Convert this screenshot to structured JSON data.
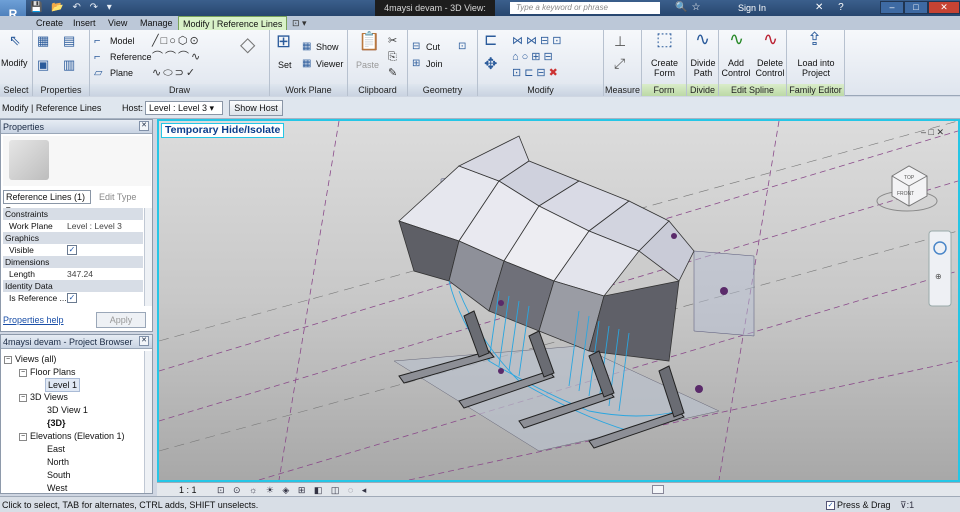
{
  "app": {
    "title": "4maysi devam - 3D View: {3D}",
    "app_button": "R"
  },
  "titlebar": {
    "search_placeholder": "Type a keyword or phrase",
    "sign_in": "Sign In",
    "qat_icons": [
      "save-icon",
      "open-icon",
      "undo-icon",
      "redo-icon"
    ],
    "win_min": "–",
    "win_max": "□",
    "win_close": "✕"
  },
  "tabs": [
    {
      "label": "Create"
    },
    {
      "label": "Insert"
    },
    {
      "label": "View"
    },
    {
      "label": "Manage"
    },
    {
      "label": "Modify | Reference Lines",
      "active": true
    }
  ],
  "ribbon": {
    "select": {
      "modify": "Modify",
      "label": "Select"
    },
    "properties": {
      "label": "Properties"
    },
    "draw": {
      "model": "Model",
      "reference": "Reference",
      "plane": "Plane",
      "label": "Draw"
    },
    "workplane": {
      "set": "Set",
      "show": "Show",
      "viewer": "Viewer",
      "label": "Work Plane"
    },
    "clipboard": {
      "paste": "Paste",
      "label": "Clipboard"
    },
    "geometry": {
      "cut": "Cut",
      "join": "Join",
      "label": "Geometry"
    },
    "modify": {
      "label": "Modify"
    },
    "measure": {
      "label": "Measure"
    },
    "form": {
      "create_form": "Create Form",
      "label": "Form"
    },
    "divide": {
      "divide_path": "Divide Path",
      "label": "Divide"
    },
    "spline": {
      "add_control": "Add Control",
      "delete_control": "Delete Control",
      "label": "Edit Spline"
    },
    "family": {
      "load_into_project": "Load into Project",
      "label": "Family Editor"
    }
  },
  "optionsbar": {
    "context": "Modify | Reference Lines",
    "host_label": "Host:",
    "host_value": "Level : Level 3",
    "show_host": "Show Host"
  },
  "properties": {
    "title": "Properties",
    "type_selector": "Reference Lines (1)",
    "edit_type": "Edit Type",
    "rows": [
      {
        "kind": "cat",
        "k": "Constraints"
      },
      {
        "kind": "val",
        "k": "Work Plane",
        "v": "Level : Level 3"
      },
      {
        "kind": "cat",
        "k": "Graphics"
      },
      {
        "kind": "chk",
        "k": "Visible",
        "v": "✓"
      },
      {
        "kind": "cat",
        "k": "Dimensions"
      },
      {
        "kind": "val",
        "k": "Length",
        "v": "347.24"
      },
      {
        "kind": "cat",
        "k": "Identity Data"
      },
      {
        "kind": "chk",
        "k": "Is Reference ...",
        "v": "✓"
      }
    ],
    "help": "Properties help",
    "apply": "Apply"
  },
  "browser": {
    "title": "4maysi devam - Project Browser",
    "nodes": [
      {
        "label": "Views (all)",
        "level": 0,
        "pm": "−"
      },
      {
        "label": "Floor Plans",
        "level": 1,
        "pm": "−"
      },
      {
        "label": "Level 1",
        "level": 2,
        "selected": true
      },
      {
        "label": "3D Views",
        "level": 1,
        "pm": "−"
      },
      {
        "label": "3D View 1",
        "level": 2
      },
      {
        "label": "{3D}",
        "level": 2,
        "bold": true
      },
      {
        "label": "Elevations (Elevation 1)",
        "level": 1,
        "pm": "−"
      },
      {
        "label": "East",
        "level": 2
      },
      {
        "label": "North",
        "level": 2
      },
      {
        "label": "South",
        "level": 2
      },
      {
        "label": "West",
        "level": 2
      }
    ]
  },
  "canvas": {
    "banner": "Temporary Hide/Isolate",
    "viewcube_front": "FRONT",
    "viewcube_top": "TOP",
    "accent": "#25c6e6"
  },
  "viewbar": {
    "scale": "1 : 1"
  },
  "status": {
    "message": "Click to select, TAB for alternates, CTRL adds, SHIFT unselects.",
    "press_drag": "Press & Drag",
    "filter": ":1"
  }
}
